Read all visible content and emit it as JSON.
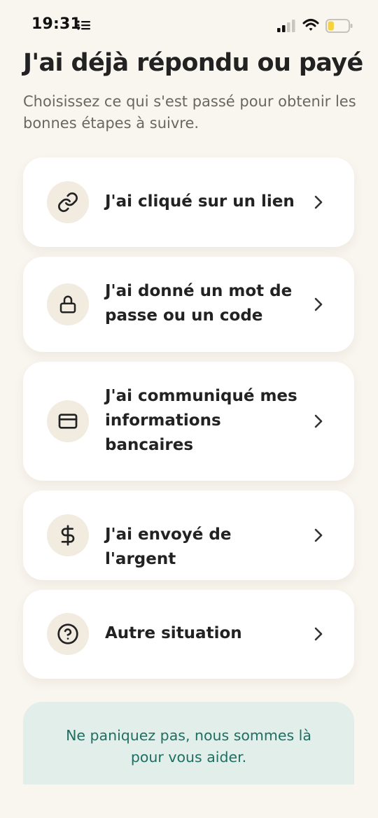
{
  "status_bar": {
    "time": "19:31",
    "list_icon": "list-icon",
    "signal_icon": "signal-icon",
    "wifi_icon": "wifi-icon",
    "battery_icon": "battery-icon",
    "battery_level": 0.3
  },
  "header": {
    "title": "J'ai déjà répondu ou payé",
    "subtitle": "Choisissez ce qui s'est passé pour obtenir les bonnes étapes à suivre."
  },
  "options": [
    {
      "label": "J'ai cliqué sur un lien",
      "icon": "link-icon"
    },
    {
      "label": "J'ai donné un mot de passe ou un code",
      "icon": "lock-icon"
    },
    {
      "label": "J'ai communiqué mes informations bancaires",
      "icon": "credit-card-icon"
    },
    {
      "label": "J'ai envoyé de l'argent",
      "icon": "dollar-icon"
    },
    {
      "label": "Autre situation",
      "icon": "question-icon"
    }
  ],
  "help_banner": {
    "text": "Ne paniquez pas, nous sommes là pour vous aider."
  },
  "colors": {
    "background": "#f9f5ef",
    "card": "#ffffff",
    "icon_circle": "#f1ebe0",
    "banner_bg": "#e1eeea",
    "banner_text": "#1e6e62",
    "battery_fill": "#f6d23c"
  }
}
